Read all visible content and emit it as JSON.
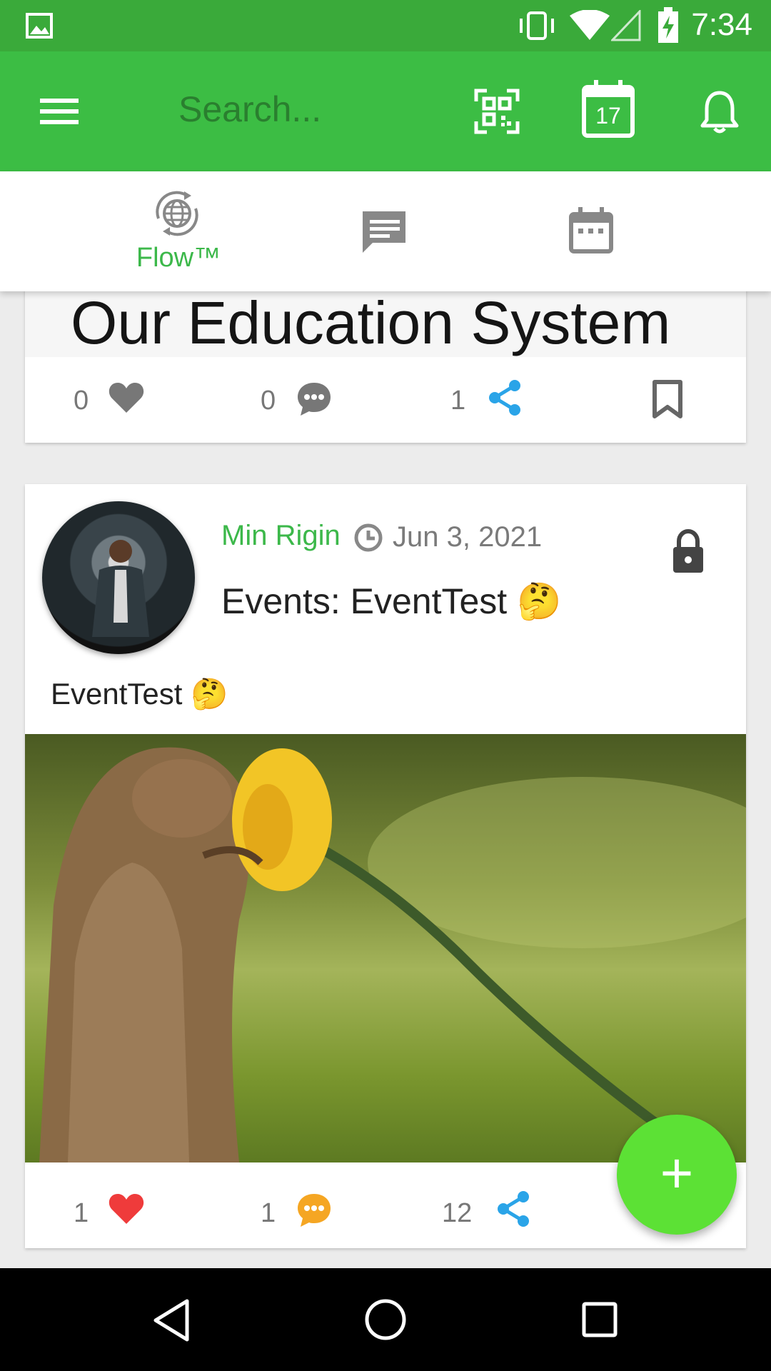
{
  "status_bar": {
    "time": "7:34"
  },
  "app_bar": {
    "search_placeholder": "Search...",
    "calendar_day": "17"
  },
  "tabs": [
    {
      "label": "Flow™",
      "icon": "globe-sync-icon",
      "active": true
    },
    {
      "label": "",
      "icon": "chat-icon",
      "active": false
    },
    {
      "label": "",
      "icon": "calendar-icon",
      "active": false
    }
  ],
  "post1": {
    "banner_text": "Our Education System",
    "likes": "0",
    "comments": "0",
    "shares": "1"
  },
  "post2": {
    "author": "Min Rigin",
    "date": "Jun 3, 2021",
    "title": "Events: EventTest 🤔",
    "body": "EventTest 🤔",
    "likes": "1",
    "comments": "1",
    "shares": "12"
  },
  "colors": {
    "status_bar": "#3aaa3a",
    "app_bar": "#3cbd44",
    "accent_green": "#3cb84a",
    "fab": "#5ce135",
    "like_active": "#ef3b3b",
    "comment_active": "#f5a623",
    "share": "#2aa4e8"
  },
  "fab": {
    "label": "+"
  }
}
